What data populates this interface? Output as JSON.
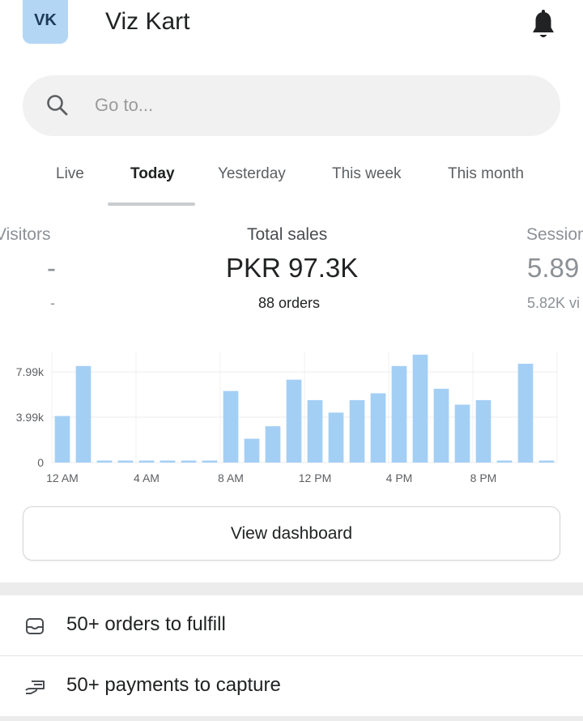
{
  "header": {
    "avatar_initials": "VK",
    "store_name": "Viz Kart",
    "notification_icon": "bell-icon"
  },
  "search": {
    "placeholder": "Go to...",
    "icon": "search-icon"
  },
  "tabs": [
    {
      "label": "Live",
      "active": false
    },
    {
      "label": "Today",
      "active": true
    },
    {
      "label": "Yesterday",
      "active": false
    },
    {
      "label": "This week",
      "active": false
    },
    {
      "label": "This month",
      "active": false
    }
  ],
  "metrics": {
    "visitors": {
      "label": "Visitors",
      "value": "-",
      "sub": "-"
    },
    "total_sales": {
      "label": "Total sales",
      "value": "PKR 97.3K",
      "sub": "88 orders"
    },
    "sessions": {
      "label": "Sessions",
      "value": "5.89",
      "sub": "5.82K vi"
    }
  },
  "chart_data": {
    "type": "bar",
    "title": "",
    "xlabel": "",
    "ylabel": "",
    "ylim": [
      0,
      9200
    ],
    "y_ticks": [
      "0",
      "3.99k",
      "7.99k"
    ],
    "y_tick_values": [
      0,
      3990,
      7990
    ],
    "x_tick_labels": [
      {
        "label": "12 AM",
        "index": 0
      },
      {
        "label": "4 AM",
        "index": 4
      },
      {
        "label": "8 AM",
        "index": 8
      },
      {
        "label": "12 PM",
        "index": 12
      },
      {
        "label": "4 PM",
        "index": 16
      },
      {
        "label": "8 PM",
        "index": 20
      }
    ],
    "categories": [
      "0",
      "1",
      "2",
      "3",
      "4",
      "5",
      "6",
      "7",
      "8",
      "9",
      "10",
      "11",
      "12",
      "13",
      "14",
      "15",
      "16",
      "17",
      "18",
      "19",
      "20",
      "21",
      "22",
      "23"
    ],
    "values": [
      4100,
      8500,
      100,
      100,
      100,
      100,
      100,
      100,
      6300,
      2100,
      3200,
      7300,
      5500,
      4400,
      5500,
      6100,
      8500,
      9500,
      6500,
      5100,
      5500,
      100,
      8700,
      100
    ],
    "bar_color": "#a4cff5",
    "grid": true
  },
  "actions": {
    "view_dashboard": "View dashboard"
  },
  "tasks": [
    {
      "label": "50+ orders to fulfill",
      "icon": "inbox-icon"
    },
    {
      "label": "50+ payments to capture",
      "icon": "payment-hand-icon"
    }
  ]
}
